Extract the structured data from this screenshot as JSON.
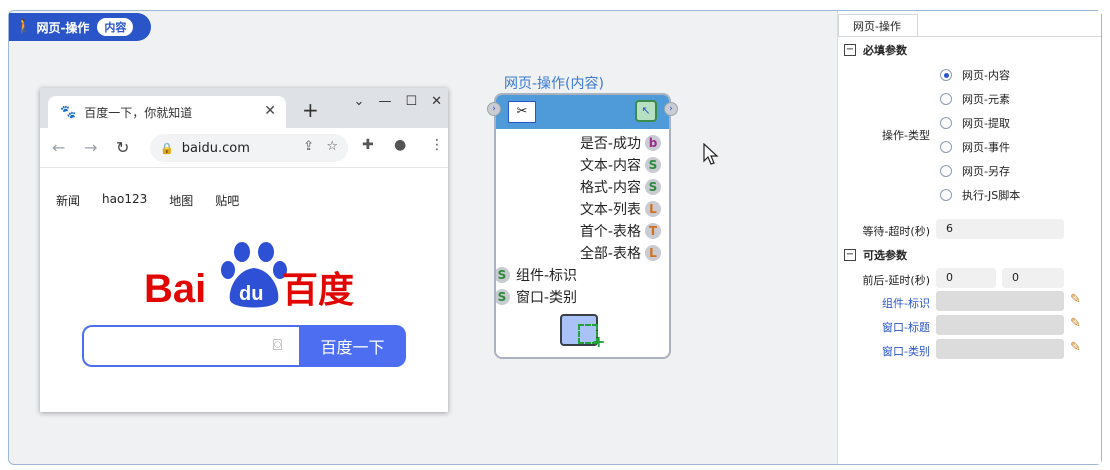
{
  "header": {
    "title": "网页-操作",
    "badge": "内容"
  },
  "browser": {
    "tab_title": "百度一下，你就知道",
    "new_tab": "+",
    "url": "baidu.com",
    "nav_links": [
      "新闻",
      "hao123",
      "地图",
      "贴吧"
    ],
    "logo_text_left": "Bai",
    "logo_text_du": "du",
    "logo_text_right": "百度",
    "search_button": "百度一下"
  },
  "node": {
    "title": "网页-操作(内容)",
    "outputs": [
      {
        "label": "是否-成功",
        "type": "b",
        "color": "#9b2c8c"
      },
      {
        "label": "文本-内容",
        "type": "S",
        "color": "#2e8b3a"
      },
      {
        "label": "格式-内容",
        "type": "S",
        "color": "#2e8b3a"
      },
      {
        "label": "文本-列表",
        "type": "L",
        "color": "#d4701a"
      },
      {
        "label": "首个-表格",
        "type": "T",
        "color": "#d4701a"
      },
      {
        "label": "全部-表格",
        "type": "L",
        "color": "#d4701a"
      }
    ],
    "inputs": [
      {
        "label": "组件-标识",
        "type": "S"
      },
      {
        "label": "窗口-类别",
        "type": "S"
      }
    ]
  },
  "panel": {
    "tab": "网页-操作",
    "required_section": "必填参数",
    "op_type_label": "操作-类型",
    "op_options": [
      "网页-内容",
      "网页-元素",
      "网页-提取",
      "网页-事件",
      "网页-另存",
      "执行-JS脚本"
    ],
    "selected_option": 0,
    "timeout_label": "等待-超时(秒)",
    "timeout_value": "6",
    "optional_section": "可选参数",
    "delay_label": "前后-延时(秒)",
    "delay_before": "0",
    "delay_after": "0",
    "component_id_label": "组件-标识",
    "window_title_label": "窗口-标题",
    "window_class_label": "窗口-类别"
  },
  "colors": {
    "accent": "#2a55c9",
    "node_header": "#4f9bd9",
    "baidu_blue": "#4e6ef2",
    "baidu_red": "#e10602"
  }
}
